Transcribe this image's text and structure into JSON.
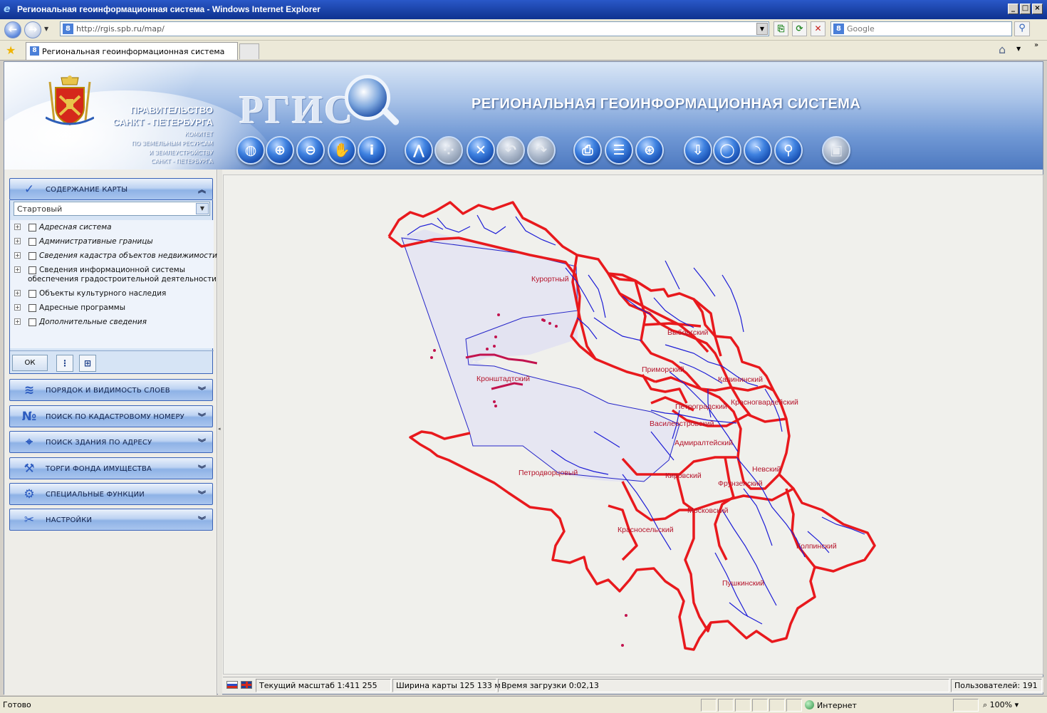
{
  "window": {
    "title": "Региональная геоинформационная система - Windows Internet Explorer"
  },
  "browser": {
    "url": "http://rgis.spb.ru/map/",
    "search_placeholder": "Google",
    "tab_title": "Региональная геоинформационная система",
    "status_text": "Готово",
    "zone": "Интернет",
    "zoom": "100%"
  },
  "header": {
    "gov_line1": "ПРАВИТЕЛЬСТВО",
    "gov_line2": "САНКТ - ПЕТЕРБУРГА",
    "committee": [
      "КОМИТЕТ",
      "ПО ЗЕМЕЛЬНЫМ РЕСУРСАМ",
      "И ЗЕМЛЕУСТРОЙСТВУ",
      "САНКТ - ПЕТЕРБУРГА"
    ],
    "logo": "РГИС",
    "system_title": "РЕГИОНАЛЬНАЯ  ГЕОИНФОРМАЦИОННАЯ СИСТЕМА"
  },
  "toolbar": [
    {
      "name": "full-extent",
      "icon": "globe-icon",
      "glyph": "◍",
      "disabled": false
    },
    {
      "name": "zoom-in",
      "icon": "zoom-in-icon",
      "glyph": "⊕",
      "disabled": false
    },
    {
      "name": "zoom-out",
      "icon": "zoom-out-icon",
      "glyph": "⊖",
      "disabled": false
    },
    {
      "name": "pan",
      "icon": "hand-icon",
      "glyph": "✋",
      "disabled": false
    },
    {
      "name": "info",
      "icon": "info-icon",
      "glyph": "i",
      "disabled": false
    },
    {
      "name": "measure",
      "icon": "compass-icon",
      "glyph": "⋀",
      "disabled": false
    },
    {
      "name": "select",
      "icon": "select-icon",
      "glyph": "⁘",
      "disabled": true
    },
    {
      "name": "clear",
      "icon": "clear-icon",
      "glyph": "✕",
      "disabled": false
    },
    {
      "name": "back",
      "icon": "undo-icon",
      "glyph": "↶",
      "disabled": true
    },
    {
      "name": "forward",
      "icon": "redo-icon",
      "glyph": "↷",
      "disabled": true
    },
    {
      "name": "print",
      "icon": "print-icon",
      "glyph": "⎙",
      "disabled": false
    },
    {
      "name": "legend",
      "icon": "list-icon",
      "glyph": "☰",
      "disabled": false
    },
    {
      "name": "coordinates",
      "icon": "globe-grid-icon",
      "glyph": "⊛",
      "disabled": false
    },
    {
      "name": "download",
      "icon": "download-icon",
      "glyph": "⇩",
      "disabled": false
    },
    {
      "name": "comment",
      "icon": "speech-bubble-icon",
      "glyph": "◯",
      "disabled": false
    },
    {
      "name": "rss",
      "icon": "rss-icon",
      "glyph": "◝",
      "disabled": false
    },
    {
      "name": "placemark",
      "icon": "pin-icon",
      "glyph": "⚲",
      "disabled": false
    },
    {
      "name": "export",
      "icon": "export-icon",
      "glyph": "▣",
      "disabled": true
    }
  ],
  "sidebar": {
    "content_header": "СОДЕРЖАНИЕ КАРТЫ",
    "preset": "Стартовый",
    "layers": [
      {
        "label": "Адресная система",
        "italic": true
      },
      {
        "label": "Административные границы",
        "italic": true
      },
      {
        "label": "Сведения кадастра объектов недвижимости",
        "italic": true
      },
      {
        "label": "Сведения информационной системы",
        "label2": "обеспечения градостроительной деятельности",
        "italic": false
      },
      {
        "label": "Объекты культурного наследия",
        "italic": false
      },
      {
        "label": "Адресные программы",
        "italic": false
      },
      {
        "label": "Дополнительные сведения",
        "italic": true
      }
    ],
    "ok_label": "ОК",
    "sections": [
      {
        "label": "ПОРЯДОК И ВИДИМОСТЬ СЛОЕВ",
        "icon": "layers-icon",
        "glyph": "≋"
      },
      {
        "label": "ПОИСК ПО КАДАСТРОВОМУ НОМЕРУ",
        "icon": "cadastre-search-icon",
        "glyph": "№"
      },
      {
        "label": "ПОИСК ЗДАНИЯ ПО АДРЕСУ",
        "icon": "address-search-icon",
        "glyph": "⌖"
      },
      {
        "label": "ТОРГИ ФОНДА ИМУЩЕСТВА",
        "icon": "gavel-icon",
        "glyph": "⚒"
      },
      {
        "label": "СПЕЦИАЛЬНЫЕ ФУНКЦИИ",
        "icon": "gear-icon",
        "glyph": "⚙"
      },
      {
        "label": "НАСТРОЙКИ",
        "icon": "tools-icon",
        "glyph": "✂"
      }
    ]
  },
  "map": {
    "districts": [
      "Курортный",
      "Выборгский",
      "Приморский",
      "Калининский",
      "Кронштадтский",
      "Петроградский",
      "Красногвардейский",
      "Василеостровский",
      "Адмиралтейский",
      "Невский",
      "Кировский",
      "Фрунзенский",
      "Петродворцовый",
      "Московский",
      "Красносельский",
      "Колпинский",
      "Пушкинский"
    ],
    "colors": {
      "boundary": "#e8191d",
      "water": "#1c1cd6",
      "sea": "#e6e6f2"
    }
  },
  "map_status": {
    "scale": "Текущий масштаб 1:411 255",
    "width": "Ширина карты 125 133 м",
    "load_time": "Время загрузки 0:02,13",
    "users": "Пользователей: 191"
  }
}
